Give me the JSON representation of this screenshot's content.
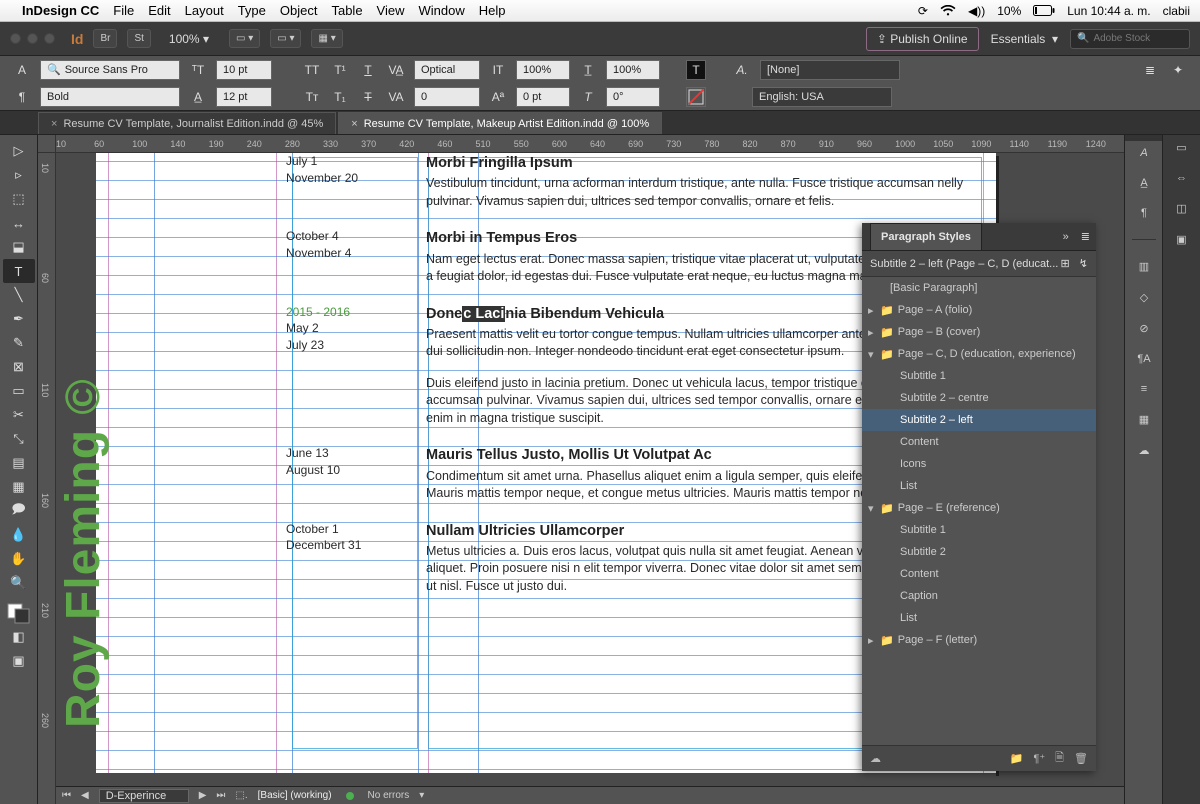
{
  "mac": {
    "app": "InDesign CC",
    "menus": [
      "File",
      "Edit",
      "Layout",
      "Type",
      "Object",
      "Table",
      "View",
      "Window",
      "Help"
    ],
    "battery": "10%",
    "time": "Lun 10:44 a. m.",
    "user": "clabii"
  },
  "appbar": {
    "zoom": "100%",
    "publish": "Publish Online",
    "workspace": "Essentials",
    "search_placeholder": "Adobe Stock"
  },
  "control": {
    "font": "Source Sans Pro",
    "weight": "Bold",
    "size": "10 pt",
    "leading": "12 pt",
    "kerning_mode": "Optical",
    "tracking": "0",
    "scale_v": "100%",
    "scale_h": "100%",
    "baseline": "0 pt",
    "skew": "0°",
    "char_style": "[None]",
    "language": "English: USA"
  },
  "tabs": [
    {
      "label": "Resume CV Template, Journalist Edition.indd @ 45%",
      "active": false
    },
    {
      "label": "Resume CV Template, Makeup Artist Edition.indd @ 100%",
      "active": true
    }
  ],
  "ruler_h": [
    "10",
    "60",
    "100",
    "140",
    "190",
    "240",
    "280",
    "330",
    "370",
    "420",
    "460",
    "510",
    "550",
    "600",
    "640",
    "690",
    "730",
    "780",
    "820",
    "870",
    "910",
    "960",
    "1000",
    "1050",
    "1090",
    "1140",
    "1190",
    "1240"
  ],
  "ruler_v": [
    "10",
    "60",
    "110",
    "160",
    "210",
    "260"
  ],
  "watermark": "Roy Fleming ©",
  "doc": {
    "entries": [
      {
        "dates": [
          "July 1",
          "November 20"
        ],
        "title": "Morbi Fringilla Ipsum",
        "body": "Vestibulum tincidunt, urna acforman interdum tristique, ante nulla. Fusce tristique accumsan nelly pulvinar. Vivamus sapien dui, ultrices sed tempor convallis, ornare et felis."
      },
      {
        "dates": [
          "October 4",
          "November 4"
        ],
        "title": "Morbi in Tempus Eros",
        "body": "Nam eget lectus erat. Donec massa sapien, tristique vitae placerat ut, vulputate sit amet velit. Mauris a feugiat dolor, id egestas dui. Fusce vulputate erat neque, eu luctus magna mattis sit am."
      },
      {
        "year": "2015 - 2016",
        "dates": [
          "May 2",
          "July 23"
        ],
        "title_pre": "Done",
        "title_hi": "c Laci",
        "title_post": "nia Bibendum Vehicula",
        "body": "Praesent mattis velit eu tortor congue tempus. Nullam ultricies ullamcorper ante, eget coma fringilla dui sollicitudin non. Integer nondeodo tincidunt erat eget consectetur ipsum.",
        "body2": "Duis eleifend justo in lacinia pretium. Donec ut vehicula lacus, tempor tristique orci. Fusce tristique accumsan pulvinar. Vivamus sapien dui, ultrices sed tempor convallis, ornare et felis. Donec dictum enim in magna tristique suscipit."
      },
      {
        "dates": [
          "June 13",
          "August 10"
        ],
        "title": "Mauris Tellus Justo, Mollis Ut Volutpat Ac",
        "body": "Condimentum sit amet urna. Phasellus aliquet enim a ligula semper, quis eleifend arcu consequat. Mauris mattis tempor neque, et congue metus ultricies. Mauris mattis tempor neque, et congue."
      },
      {
        "dates": [
          "October 1",
          "Decembert 31"
        ],
        "title": "Nullam Ultricies Ullamcorper",
        "body": "Metus ultricies a. Duis eros lacus, volutpat quis nulla sit amet feugiat. Aenean volutpat leo ut ultricies aliquet. Proin posuere nisi n elit tempor viverra. Donec vitae dolor sit amet sem molestie sodales eu ut nisl. Fusce ut justo dui."
      }
    ]
  },
  "panel": {
    "title": "Paragraph Styles",
    "current": "Subtitle 2 – left (Page – C, D (educat...",
    "groups": [
      {
        "type": "row",
        "label": "[Basic Paragraph]"
      },
      {
        "type": "group",
        "open": false,
        "label": "Page – A (folio)"
      },
      {
        "type": "group",
        "open": false,
        "label": "Page – B (cover)"
      },
      {
        "type": "group",
        "open": true,
        "label": "Page – C, D (education, experience)",
        "items": [
          "Subtitle 1",
          "Subtitle 2 – centre",
          "Subtitle 2 – left",
          "Content",
          "Icons",
          "List"
        ],
        "selected": "Subtitle 2 – left"
      },
      {
        "type": "group",
        "open": true,
        "label": "Page – E (reference)",
        "items": [
          "Subtitle 1",
          "Subtitle 2",
          "Content",
          "Caption",
          "List"
        ]
      },
      {
        "type": "group",
        "open": false,
        "label": "Page – F (letter)"
      }
    ]
  },
  "status": {
    "page": "D-Experince",
    "preflight": "[Basic] (working)",
    "errors": "No errors"
  }
}
